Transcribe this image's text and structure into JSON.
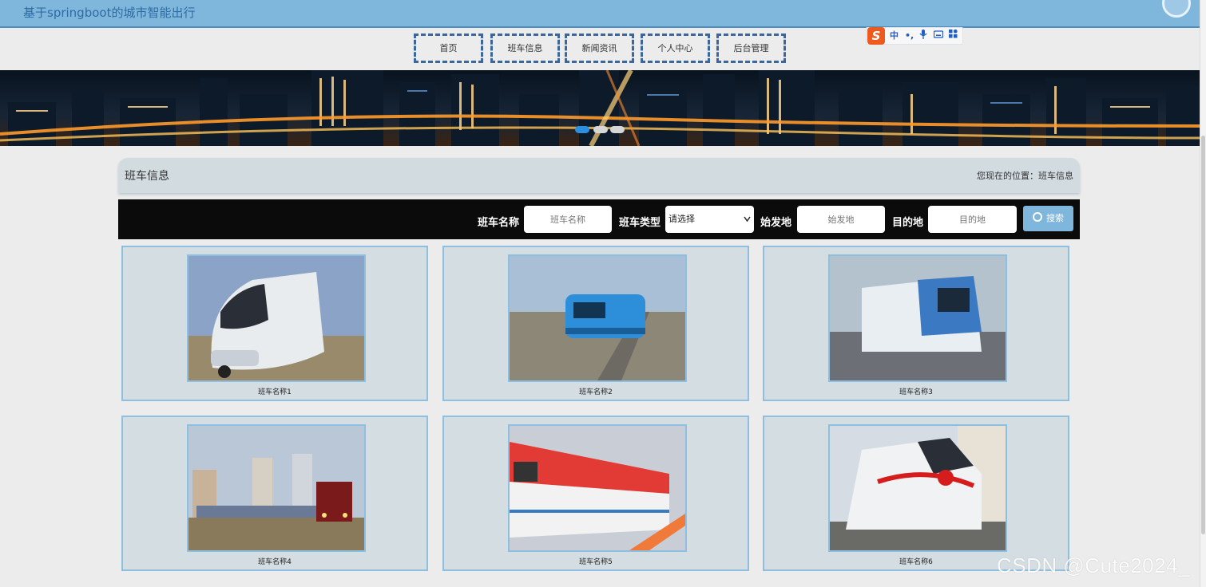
{
  "header": {
    "site_title": "基于springboot的城市智能出行"
  },
  "nav": {
    "items": [
      {
        "label": "首页"
      },
      {
        "label": "班车信息"
      },
      {
        "label": "新闻资讯"
      },
      {
        "label": "个人中心"
      },
      {
        "label": "后台管理"
      }
    ]
  },
  "ime_toolbar": {
    "logo": "S",
    "items": [
      {
        "icon": "chinese-mode-icon",
        "label": "中"
      },
      {
        "icon": "punctuation-icon",
        "label": "•,"
      },
      {
        "icon": "microphone-icon",
        "label": "🎤"
      },
      {
        "icon": "keyboard-icon",
        "label": "⌨"
      },
      {
        "icon": "apps-grid-icon",
        "label": "▦"
      }
    ]
  },
  "banner": {
    "slide_count": 3,
    "active_slide": 1
  },
  "breadcrumb": {
    "title": "班车信息",
    "location_prefix": "您现在的位置：",
    "location": "班车信息"
  },
  "search": {
    "name_label": "班车名称",
    "name_placeholder": "班车名称",
    "type_label": "班车类型",
    "type_selected": "请选择",
    "origin_label": "始发地",
    "origin_placeholder": "始发地",
    "destination_label": "目的地",
    "destination_placeholder": "目的地",
    "button_label": "搜索"
  },
  "buses": [
    {
      "name": "班车名称1",
      "image": "white-metro-train-photo"
    },
    {
      "name": "班车名称2",
      "image": "blue-train-on-tracks-photo"
    },
    {
      "name": "班车名称3",
      "image": "blue-white-train-at-platform-photo"
    },
    {
      "name": "班车名称4",
      "image": "red-locomotive-city-photo"
    },
    {
      "name": "班车名称5",
      "image": "red-white-train-photo"
    },
    {
      "name": "班车名称6",
      "image": "white-train-red-ribbon-photo"
    }
  ],
  "watermark": "CSDN @Cute2024_"
}
